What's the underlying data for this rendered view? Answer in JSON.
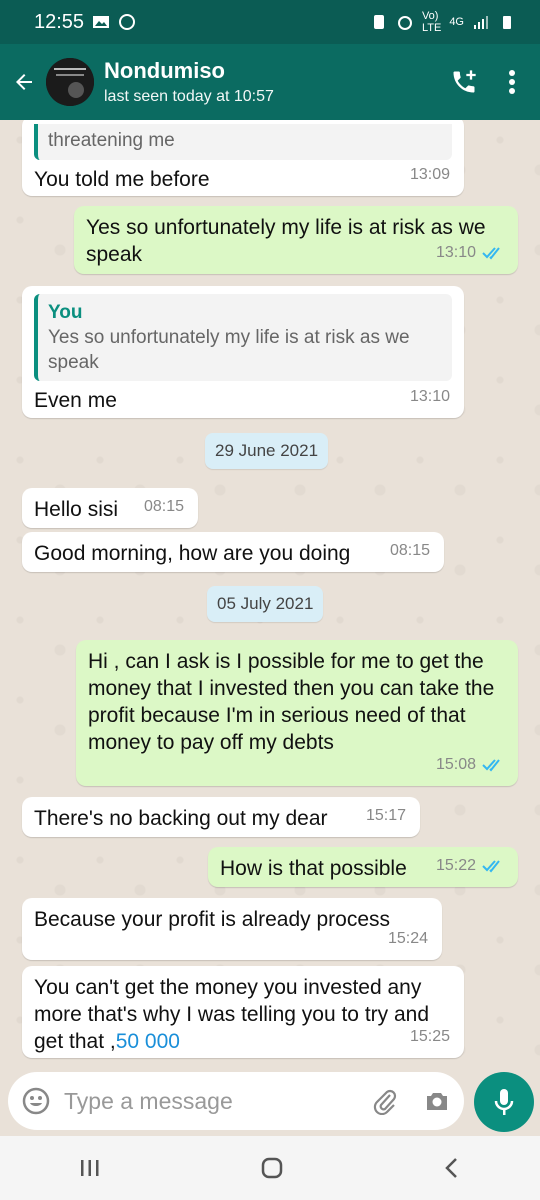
{
  "status": {
    "time": "12:55",
    "network": "4G"
  },
  "header": {
    "contact_name": "Nondumiso",
    "last_seen": "last seen today at 10:57"
  },
  "messages": {
    "m0": {
      "quoted_text": "threatening me",
      "text": "You told me before",
      "time": "13:09"
    },
    "m1": {
      "text": "Yes so unfortunately my life is at risk as we speak",
      "time": "13:10"
    },
    "m2": {
      "quote_name": "You",
      "quoted_text": "Yes so unfortunately my life is at risk as we speak",
      "text": "Even me",
      "time": "13:10"
    },
    "d1": "29 June 2021",
    "m3": {
      "text": "Hello sisi",
      "time": "08:15"
    },
    "m4": {
      "text": "Good morning, how are you doing",
      "time": "08:15"
    },
    "d2": "05 July 2021",
    "m5": {
      "text": "Hi , can I ask is I possible for me to get the money that I invested then you can take the profit because I'm in serious need of that money to pay off my debts",
      "time": "15:08"
    },
    "m6": {
      "text": "There's no backing out my dear",
      "time": "15:17"
    },
    "m7": {
      "text": "How is that possible",
      "time": "15:22"
    },
    "m8": {
      "text": "Because your profit is already process",
      "time": "15:24"
    },
    "m9": {
      "text_before": "You can't get the money you invested any more that's why I was telling you to try and get that ,",
      "link": "50 000",
      "time": "15:25"
    }
  },
  "input": {
    "placeholder": "Type a message"
  },
  "colors": {
    "header": "#0b6b61",
    "statusbar": "#0b5c54",
    "outgoing": "#dcf8c6",
    "incoming": "#ffffff",
    "accent": "#0b8f7f",
    "read_ticks": "#34b7f1",
    "link": "#1a8fd9"
  },
  "icons": [
    "back-arrow-icon",
    "avatar",
    "add-call-icon",
    "more-vert-icon",
    "emoji-icon",
    "attach-icon",
    "camera-icon",
    "mic-icon",
    "recents-icon",
    "home-icon",
    "back-nav-icon"
  ]
}
